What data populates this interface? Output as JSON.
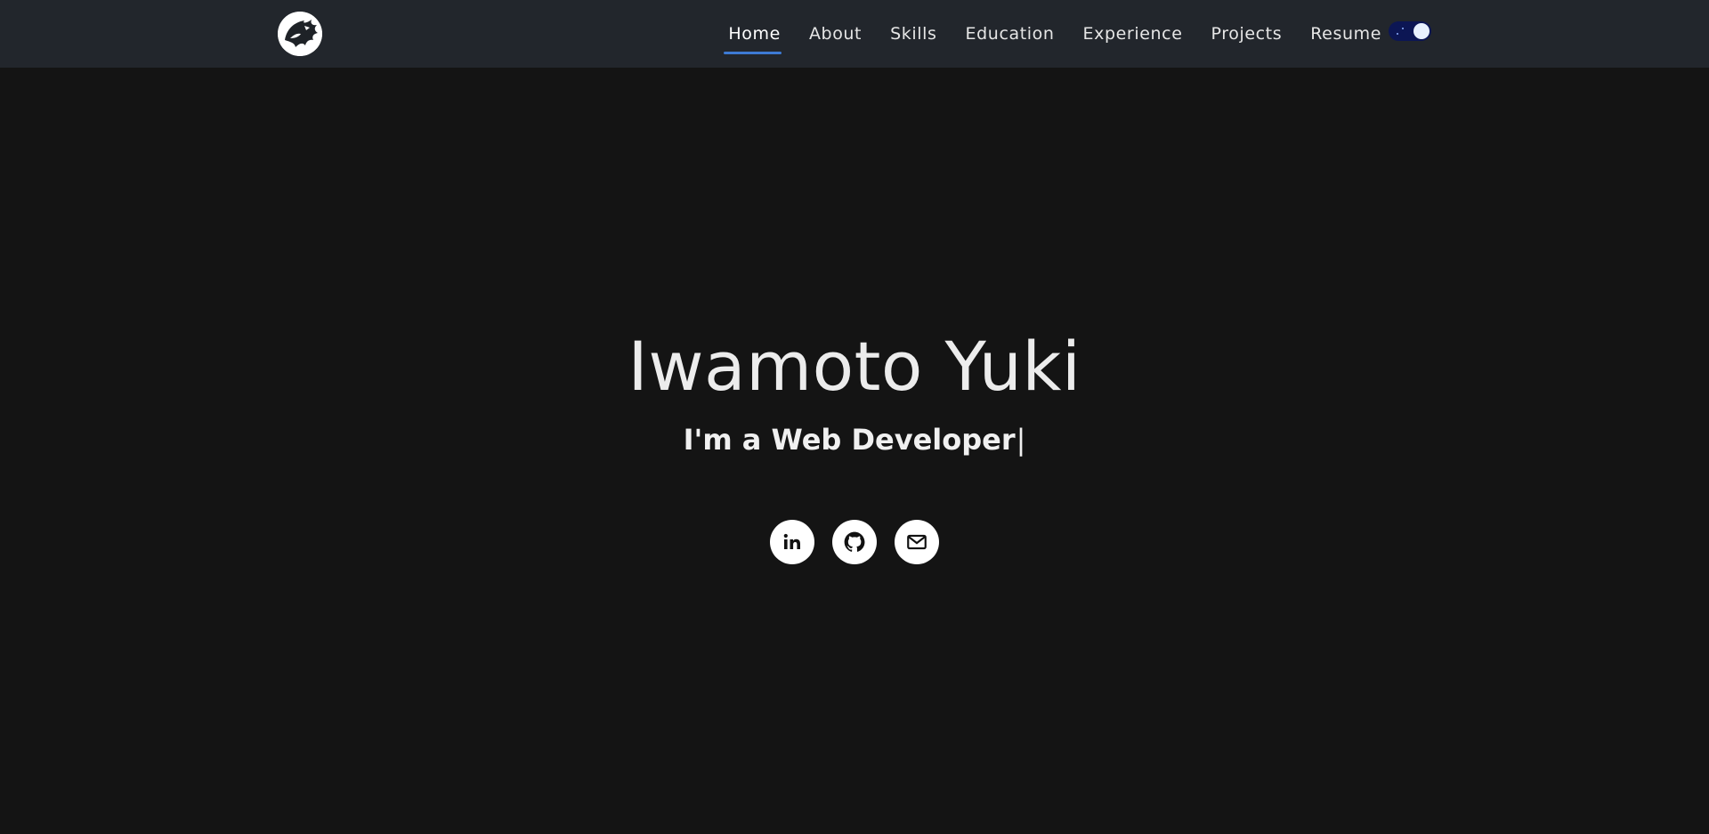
{
  "navbar": {
    "logo_icon": "dragon-logo-icon",
    "items": [
      {
        "label": "Home",
        "active": true
      },
      {
        "label": "About",
        "active": false
      },
      {
        "label": "Skills",
        "active": false
      },
      {
        "label": "Education",
        "active": false
      },
      {
        "label": "Experience",
        "active": false
      },
      {
        "label": "Projects",
        "active": false
      },
      {
        "label": "Resume",
        "active": false
      }
    ],
    "theme_toggle": {
      "icon": "dark-mode-toggle",
      "state": "dark"
    },
    "accent_color": "#3d7ad4"
  },
  "hero": {
    "name": "Iwamoto Yuki",
    "subtitle_prefix": "I'm a ",
    "subtitle_role": "Web Developer",
    "cursor": "|",
    "socials": [
      {
        "icon": "linkedin-icon"
      },
      {
        "icon": "github-icon"
      },
      {
        "icon": "mail-icon"
      }
    ]
  },
  "colors": {
    "background": "#141414",
    "navbar_background": "#22262c",
    "text": "#eaeaea"
  }
}
